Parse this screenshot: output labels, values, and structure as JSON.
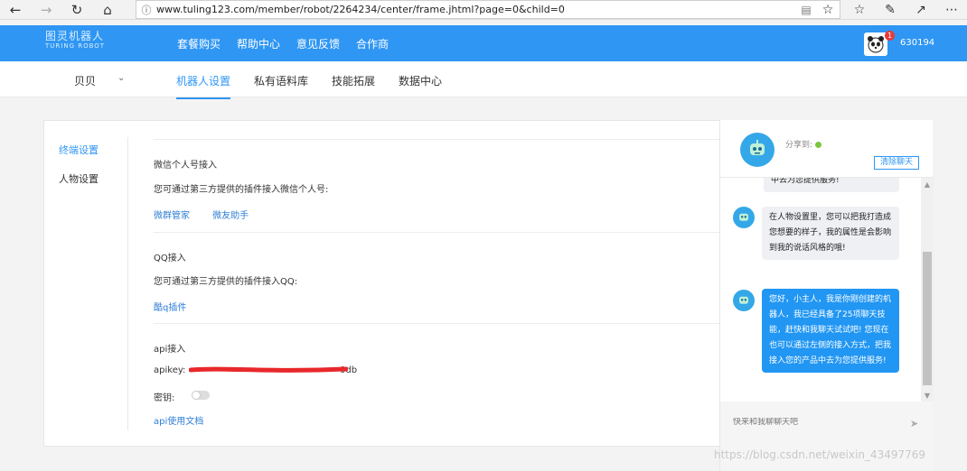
{
  "browser": {
    "url": "www.tuling123.com/member/robot/2264234/center/frame.jhtml?page=0&child=0"
  },
  "header": {
    "logo_cn": "图灵机器人",
    "logo_en": "TURING ROBOT",
    "nav": [
      "套餐购买",
      "帮助中心",
      "意见反馈",
      "合作商"
    ],
    "badge_count": "1",
    "user_id": "630194"
  },
  "subnav": {
    "bot_name": "贝贝",
    "tabs": [
      "机器人设置",
      "私有语料库",
      "技能拓展",
      "数据中心"
    ]
  },
  "left_menu": [
    "终端设置",
    "人物设置"
  ],
  "sections": {
    "wechat": {
      "title": "微信个人号接入",
      "desc": "您可通过第三方提供的插件接入微信个人号:",
      "links": [
        "微群管家",
        "微友助手"
      ]
    },
    "qq": {
      "title": "QQ接入",
      "desc": "您可通过第三方提供的插件接入QQ:",
      "links": [
        "酷q插件"
      ]
    },
    "api": {
      "title": "api接入",
      "apikey_label": "apikey:",
      "apikey_tail": "0db",
      "secret_label": "密钥:",
      "doc_link": "api使用文档"
    }
  },
  "chat": {
    "share_label": "分享到:",
    "clear_label": "清除聊天",
    "messages": [
      "中去为您提供服务!",
      "在人物设置里，您可以把我打造成您想要的样子，我的属性是会影响到我的说话风格的哦!",
      "您好，小主人，我是你刚创建的机器人，我已经具备了25项聊天技能，赶快和我聊天试试吧! 您现在也可以通过左侧的接入方式，把我接入您的产品中去为您提供服务!"
    ],
    "input_placeholder": "快来和我聊聊天吧"
  },
  "watermark": "https://blog.csdn.net/weixin_43497769",
  "colors": {
    "brand": "#2f96f3",
    "link": "#2f7fd6"
  }
}
